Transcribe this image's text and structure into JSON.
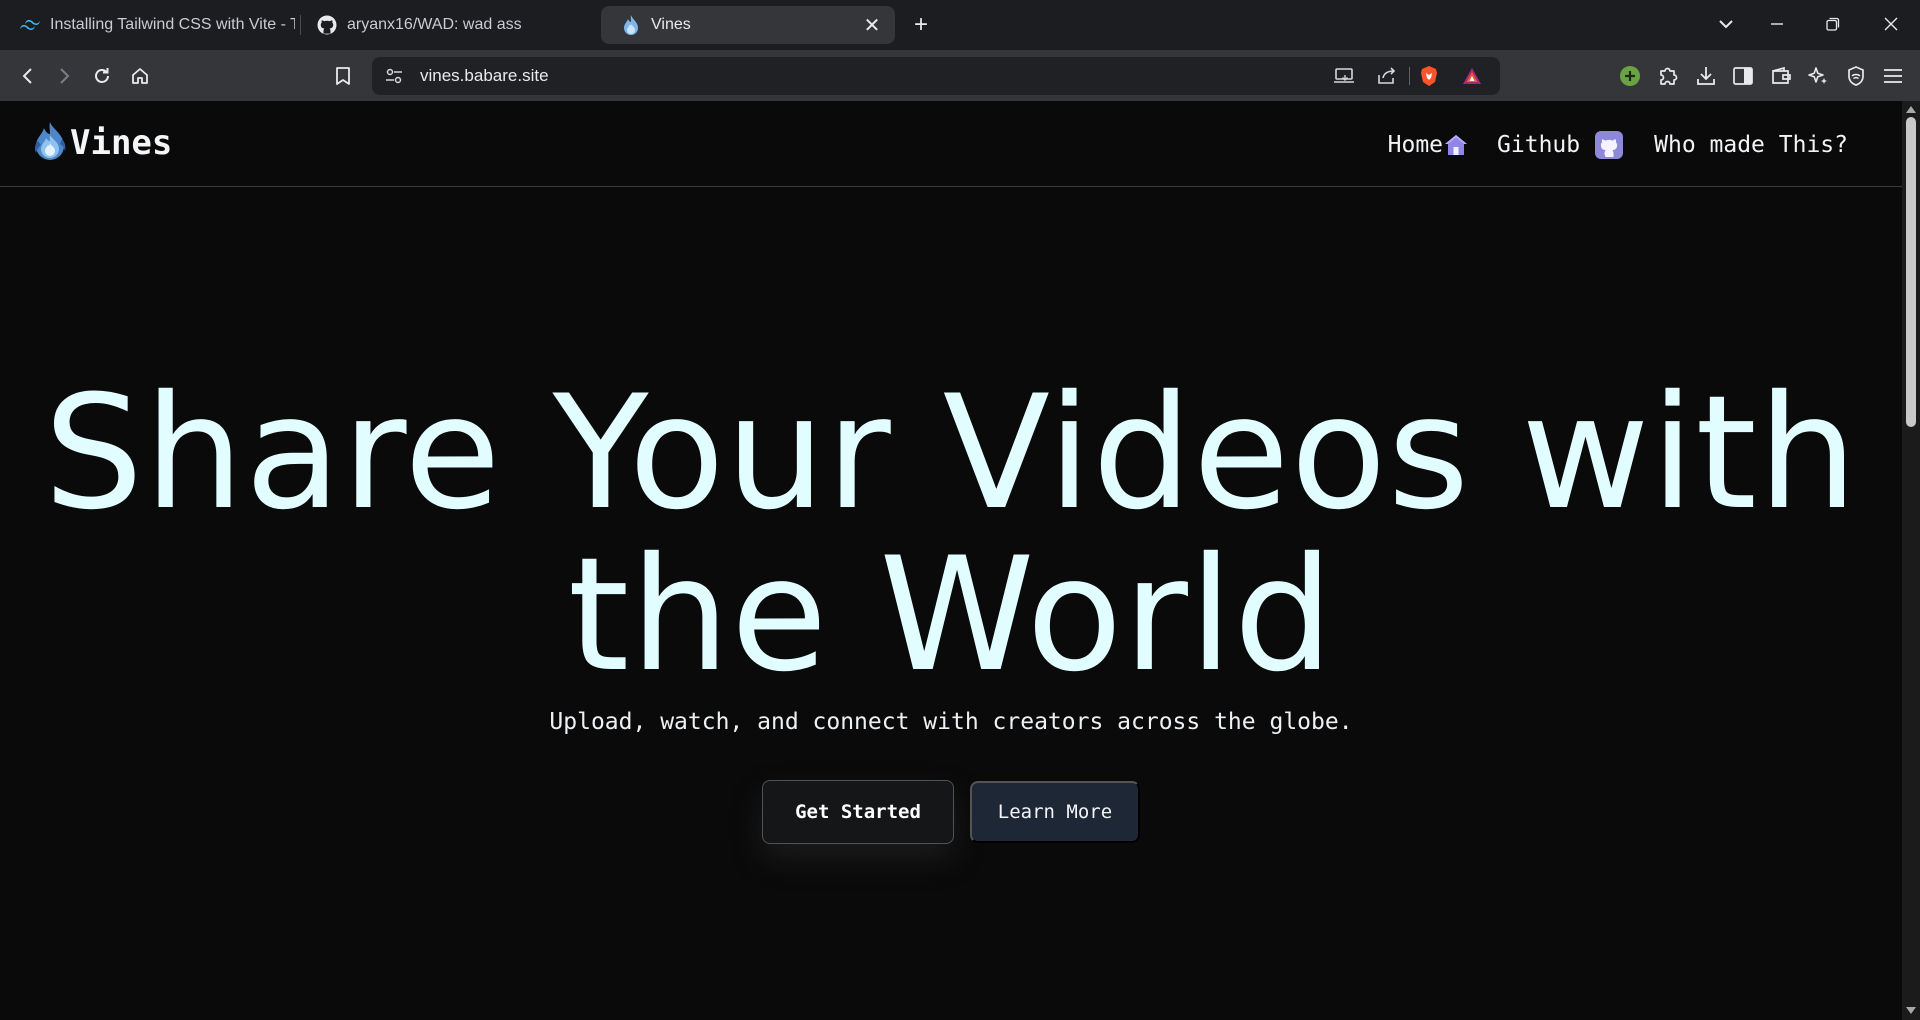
{
  "browser": {
    "tabs": [
      {
        "title": "Installing Tailwind CSS with Vite - Ta",
        "icon": "tailwind-icon",
        "active": false
      },
      {
        "title": "aryanx16/WAD: wad ass",
        "icon": "github-icon",
        "active": false
      },
      {
        "title": "Vines",
        "icon": "flame-icon",
        "active": true
      }
    ],
    "url": "vines.babare.site"
  },
  "site": {
    "brand": "Vines",
    "nav": {
      "home": "Home",
      "github": "Github",
      "who": "Who made This?"
    },
    "hero": {
      "title": "Share Your Videos with the World",
      "subtitle": "Upload, watch, and connect with creators across the globe.",
      "primary_button": "Get Started",
      "secondary_button": "Learn More"
    }
  },
  "colors": {
    "background": "#0a0a0b",
    "hero_title": "#e2fdff",
    "secondary_button": "#1e2735"
  }
}
